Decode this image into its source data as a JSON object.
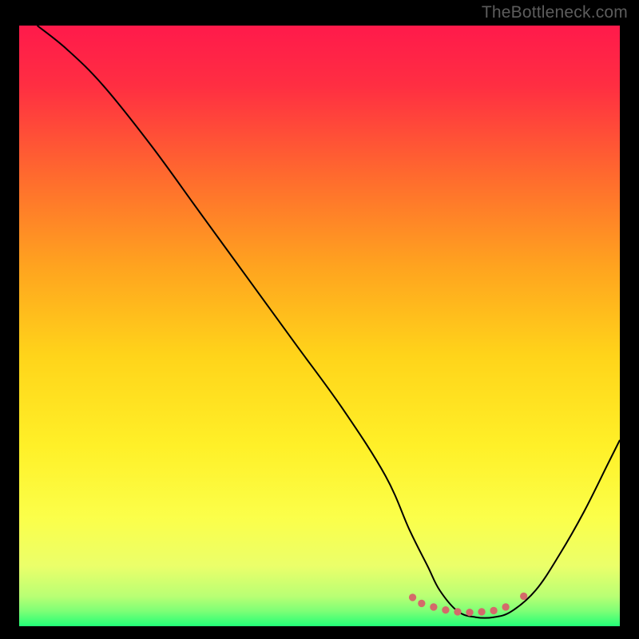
{
  "watermark": "TheBottleneck.com",
  "chart_data": {
    "type": "line",
    "title": "",
    "xlabel": "",
    "ylabel": "",
    "xlim": [
      0,
      100
    ],
    "ylim": [
      0,
      100
    ],
    "grid": false,
    "legend": false,
    "gradient_stops": [
      {
        "offset": 0.0,
        "color": "#ff1a4b"
      },
      {
        "offset": 0.1,
        "color": "#ff2e42"
      },
      {
        "offset": 0.25,
        "color": "#ff6a2e"
      },
      {
        "offset": 0.4,
        "color": "#ffa31f"
      },
      {
        "offset": 0.55,
        "color": "#ffd41a"
      },
      {
        "offset": 0.7,
        "color": "#fff028"
      },
      {
        "offset": 0.82,
        "color": "#fbff4a"
      },
      {
        "offset": 0.9,
        "color": "#ebff6a"
      },
      {
        "offset": 0.95,
        "color": "#b9ff74"
      },
      {
        "offset": 0.975,
        "color": "#7dff76"
      },
      {
        "offset": 1.0,
        "color": "#22ff77"
      }
    ],
    "series": [
      {
        "name": "bottleneck-curve",
        "color": "#000000",
        "x": [
          3,
          8,
          14,
          22,
          30,
          38,
          46,
          54,
          61,
          65,
          68,
          70,
          73,
          76,
          79,
          82,
          86,
          90,
          94,
          98,
          100
        ],
        "y": [
          100,
          96,
          90,
          80,
          69,
          58,
          47,
          36,
          25,
          16,
          10,
          6,
          2.5,
          1.5,
          1.5,
          2.5,
          6,
          12,
          19,
          27,
          31
        ]
      }
    ],
    "highlight_points": {
      "name": "valley-dots",
      "color": "#d46a6a",
      "radius": 4.5,
      "x": [
        65.5,
        67,
        69,
        71,
        73,
        75,
        77,
        79,
        81,
        84
      ],
      "y": [
        4.8,
        3.8,
        3.2,
        2.7,
        2.4,
        2.3,
        2.4,
        2.6,
        3.2,
        5.0
      ]
    }
  }
}
